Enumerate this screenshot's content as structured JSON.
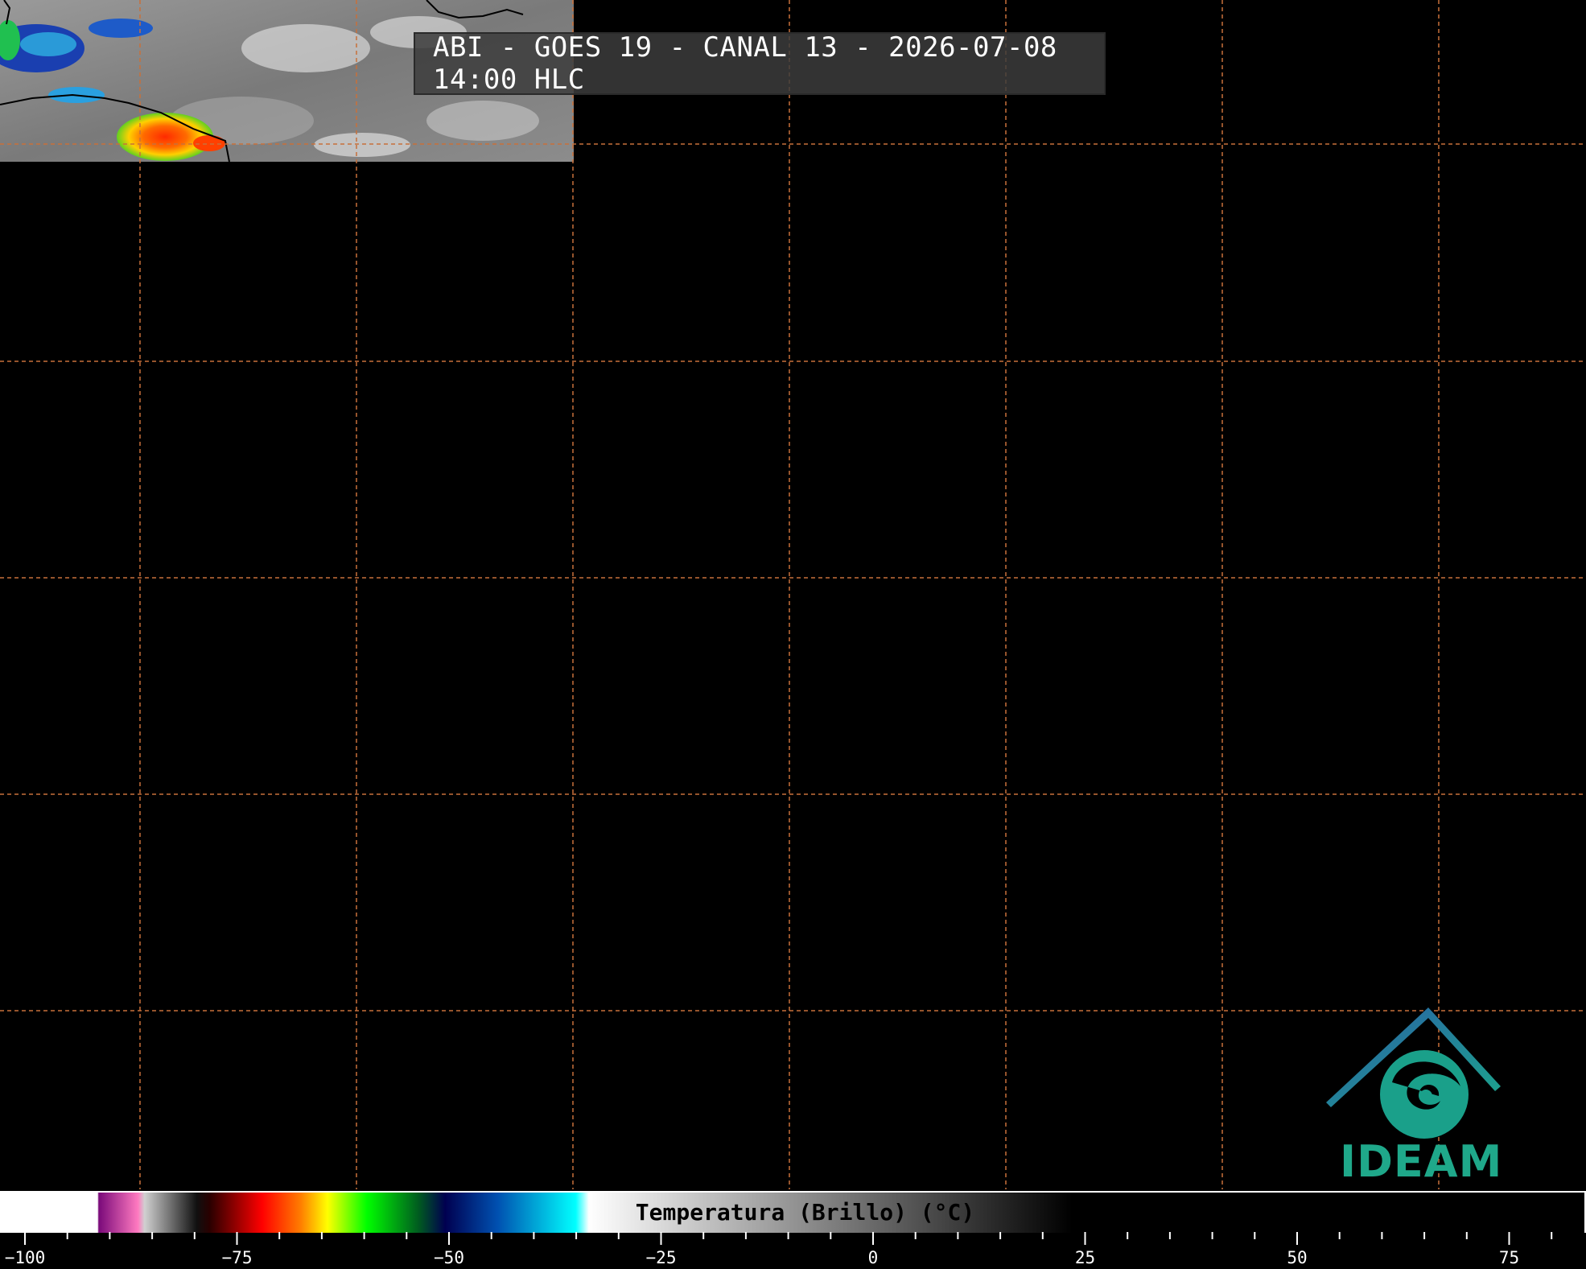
{
  "title": "ABI - GOES 19 - CANAL 13 - 2026-07-08 14:00 HLC",
  "logo_text": "IDEAM",
  "colorbar": {
    "label": "Temperatura (Brillo) (°C)",
    "min": -103,
    "max": 80,
    "ticks": [
      "-100",
      "-75",
      "-50",
      "-25",
      "0",
      "25",
      "50",
      "75"
    ],
    "tick_values": [
      -100,
      -75,
      -50,
      -25,
      0,
      25,
      50,
      75
    ]
  },
  "colors": {
    "grid": "#c8703a",
    "background": "#000000",
    "logo_blue": "#2f6fa8",
    "logo_teal": "#1fa88a"
  }
}
